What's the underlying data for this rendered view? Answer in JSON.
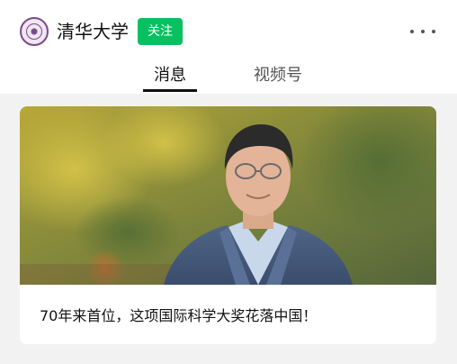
{
  "header": {
    "account_name": "清华大学",
    "follow_label": "关注",
    "follow_color": "#07c160",
    "more_icon": "more-horizontal-icon"
  },
  "tabs": [
    {
      "label": "消息",
      "active": true
    },
    {
      "label": "视频号",
      "active": false
    }
  ],
  "article": {
    "title": "70年来首位，这项国际科学大奖花落中国！"
  }
}
